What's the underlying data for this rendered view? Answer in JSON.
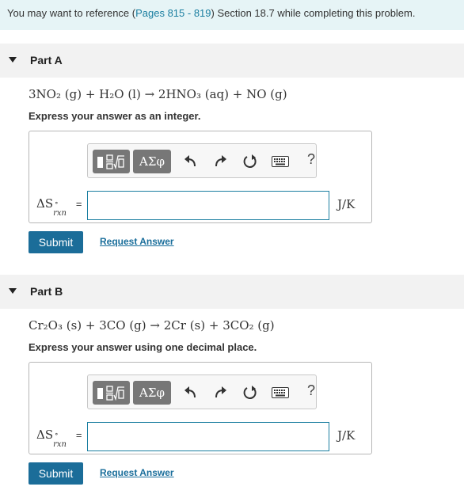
{
  "banner": {
    "prefix": "You may want to reference (",
    "link": "Pages 815 - 819",
    "suffix": ") Section 18.7 while completing this problem."
  },
  "parts": [
    {
      "title": "Part A",
      "equation": "3NO₂ (g) + H₂O (l) → 2HNO₃ (aq) + NO (g)",
      "instruction": "Express your answer as an integer.",
      "greek_label": "ΑΣφ",
      "lhs": "ΔS",
      "lhs_sub": "rxn",
      "lhs_sup": "∘",
      "equals": "=",
      "input_value": "",
      "unit": "J/K",
      "help": "?",
      "submit": "Submit",
      "request": "Request Answer"
    },
    {
      "title": "Part B",
      "equation": "Cr₂O₃ (s) + 3CO (g) → 2Cr (s) + 3CO₂ (g)",
      "instruction": "Express your answer using one decimal place.",
      "greek_label": "ΑΣφ",
      "lhs": "ΔS",
      "lhs_sub": "rxn",
      "lhs_sup": "∘",
      "equals": "=",
      "input_value": "",
      "unit": "J/K",
      "help": "?",
      "submit": "Submit",
      "request": "Request Answer"
    }
  ],
  "colors": {
    "banner_bg": "#e6f4f6",
    "link": "#1a7ea0",
    "submit_bg": "#1b6d99",
    "input_border": "#1a7ea0",
    "toolbar_button": "#777777"
  },
  "icons": [
    "templates-icon",
    "undo-icon",
    "redo-icon",
    "reset-icon",
    "keyboard-icon",
    "help-icon"
  ]
}
